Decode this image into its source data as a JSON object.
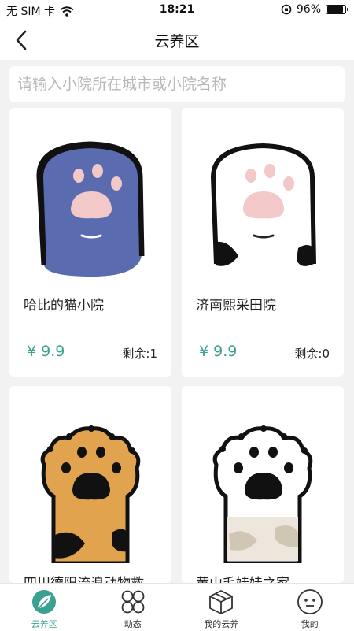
{
  "status_bar": {
    "carrier": "无 SIM 卡",
    "time": "18:21",
    "battery": "96%",
    "battery_level": 0.96
  },
  "nav": {
    "title": "云养区"
  },
  "search": {
    "placeholder": "请输入小院所在城市或小院名称",
    "value": ""
  },
  "cards": [
    {
      "name": "哈比的猫小院",
      "price": "¥ 9.9",
      "stock": "剩余:1",
      "paw": "blue-cat-paw-icon"
    },
    {
      "name": "济南熙采田院",
      "price": "¥ 9.9",
      "stock": "剩余:0",
      "paw": "white-cat-paw-icon"
    },
    {
      "name": "四川德阳流浪动物救",
      "paw": "orange-cat-paw-icon"
    },
    {
      "name": "黄山毛娃娃之家",
      "paw": "white-spotted-cat-paw-icon"
    }
  ],
  "tabs": [
    {
      "label": "云养区",
      "icon": "leaf-logo-icon",
      "active": true
    },
    {
      "label": "动态",
      "icon": "four-circles-icon"
    },
    {
      "label": "我的云养",
      "icon": "box-icon"
    },
    {
      "label": "我的",
      "icon": "face-icon"
    }
  ],
  "colors": {
    "accent": "#3aa191",
    "blue_paw": "#5a6bb0",
    "orange_paw": "#e2a34f",
    "pad_pink": "#f2c8c8"
  }
}
